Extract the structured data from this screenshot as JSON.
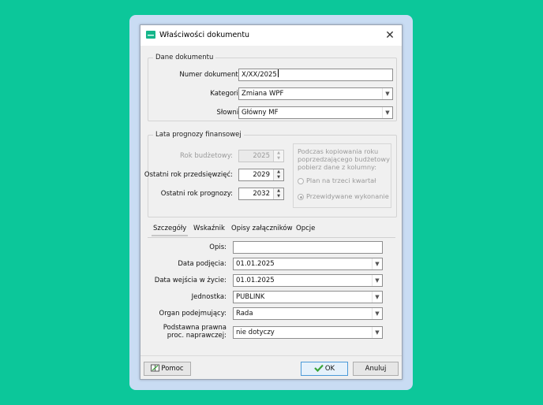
{
  "window": {
    "title": "Właściwości dokumentu"
  },
  "dane": {
    "legend": "Dane dokumentu",
    "numer_label": "Numer dokumentu:",
    "numer_value": "X/XX/2025",
    "kategoria_label": "Kategoria:",
    "kategoria_value": "Zmiana WPF",
    "slownik_label": "Słownik:",
    "slownik_value": "Główny MF"
  },
  "lata": {
    "legend": "Lata prognozy finansowej",
    "rok_budzetowy_label": "Rok budżetowy:",
    "rok_budzetowy_value": "2025",
    "ostatni_przedsiewziec_label": "Ostatni rok przedsięwzięć:",
    "ostatni_przedsiewziec_value": "2029",
    "ostatni_prognozy_label": "Ostatni rok prognozy:",
    "ostatni_prognozy_value": "2032",
    "copy_text": "Podczas kopiowania roku poprzedzającego budżetowy pobierz dane z kolumny:",
    "radio_plan": "Plan na trzeci kwartał",
    "radio_przewidywane": "Przewidywane wykonanie"
  },
  "tabs": [
    "Szczegóły",
    "Wskaźnik",
    "Opisy załączników",
    "Opcje"
  ],
  "szczegoly": {
    "opis_label": "Opis:",
    "opis_value": "",
    "data_podjecia_label": "Data podjęcia:",
    "data_podjecia_value": "01.01.2025",
    "data_wejscia_label": "Data wejścia w życie:",
    "data_wejscia_value": "01.01.2025",
    "jednostka_label": "Jednostka:",
    "jednostka_value": "PUBLINK",
    "organ_label": "Organ podejmujący:",
    "organ_value": "Rada",
    "podstawa_label_1": "Podstawna prawna",
    "podstawa_label_2": "proc. naprawczej:",
    "podstawa_value": "nie dotyczy"
  },
  "buttons": {
    "help": "Pomoc",
    "ok": "OK",
    "cancel": "Anuluj"
  },
  "colors": {
    "background": "#0cc79a",
    "frame": "#c9dcf3",
    "ok_check": "#3aa53a"
  }
}
